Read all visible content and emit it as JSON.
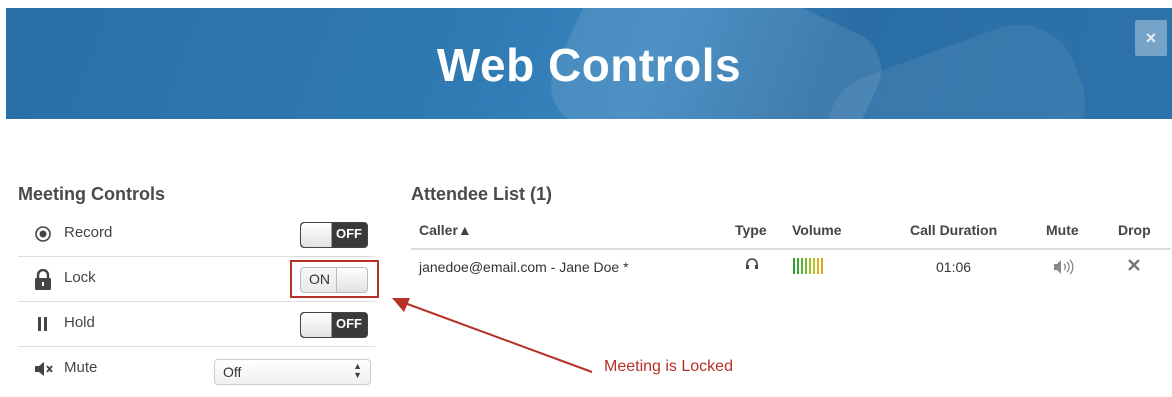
{
  "header": {
    "title": "Web Controls",
    "close_label": "×"
  },
  "meeting_controls": {
    "heading": "Meeting Controls",
    "rows": [
      {
        "label": "Record",
        "state": "OFF",
        "icon": "record-icon"
      },
      {
        "label": "Lock",
        "state": "ON",
        "icon": "lock-icon"
      },
      {
        "label": "Hold",
        "state": "OFF",
        "icon": "pause-icon"
      },
      {
        "label": "Mute",
        "icon": "mute-icon",
        "select_value": "Off"
      }
    ]
  },
  "attendee_list": {
    "heading": "Attendee List (1)",
    "columns": [
      "Caller▲",
      "Type",
      "Volume",
      "Call Duration",
      "Mute",
      "Drop"
    ],
    "rows": [
      {
        "caller": "janedoe@email.com - Jane Doe *",
        "type_icon": "headset-icon",
        "volume_colors": [
          "#2e9e2e",
          "#3aa833",
          "#55b22e",
          "#78bb28",
          "#9bc324",
          "#c2c520",
          "#d8b81c",
          "#e0a51a"
        ],
        "duration": "01:06",
        "mute_icon": "speaker-icon",
        "drop_icon": "close-icon"
      }
    ]
  },
  "annotation": {
    "text": "Meeting is Locked",
    "color": "#b73128"
  }
}
